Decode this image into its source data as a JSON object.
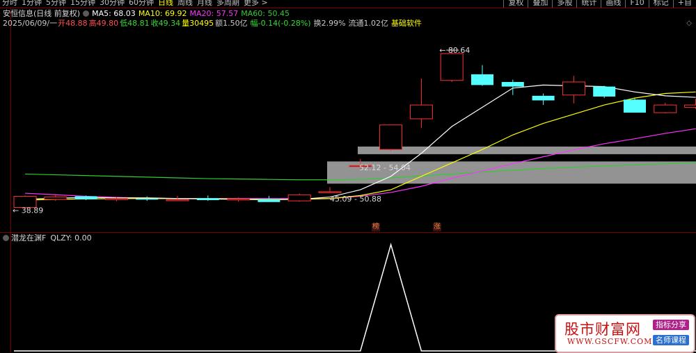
{
  "toolbar": {
    "periods": [
      "分时",
      "1分钟",
      "5分钟",
      "15分钟",
      "30分钟",
      "60分钟",
      "日线",
      "周线",
      "月线",
      "多周期",
      "更多 >"
    ],
    "active_period": "日线",
    "right_buttons": [
      "复权",
      "叠加",
      "多股",
      "统计",
      "画线",
      "F10",
      "标记",
      "+自"
    ]
  },
  "header": {
    "stock": "安恒信息(日线 前复权)",
    "ma5": "MA5: 68.03",
    "ma10": "MA10: 69.92",
    "ma20": "MA20: 57.57",
    "ma60": "MA60: 50.45",
    "date": "2025/06/09/一",
    "open": "开48.88",
    "high": "高49.80",
    "low": "低48.81",
    "close": "收49.34",
    "volume": "量30495",
    "amount": "额1.50亿",
    "change": "幅-0.14(-0.28%)",
    "turnover": "换2.99%",
    "float": "流通1.02亿",
    "sector": "基础软件",
    "corner": "◇"
  },
  "price_labels": {
    "high_mark": "80.64",
    "low_mark": "38.89",
    "zone_upper": "52.12 - 54.04",
    "zone_lower": "45.09 - 50.88"
  },
  "markers": {
    "m1": "榜",
    "m2": "涨"
  },
  "indicator": {
    "name": "潜龙在渊F",
    "value": "QLZY: 0.00"
  },
  "watermark": {
    "title": "股市财富网",
    "url": "WWW.GSCFW.COM",
    "tag1": "指标分享",
    "tag2": "名师课程"
  },
  "colors": {
    "up": "#ff3232",
    "down": "#54ffff",
    "ma5": "#ffffff",
    "ma10": "#ffff00",
    "ma20": "#ff33ff",
    "ma60": "#33cc33",
    "zone": "#a0a0a0"
  },
  "chart_data": {
    "type": "candlestick",
    "y_range": [
      35,
      85
    ],
    "candles": [
      {
        "o": 38.9,
        "h": 42.0,
        "l": 38.89,
        "c": 41.8
      },
      {
        "o": 41.0,
        "h": 42.4,
        "l": 40.6,
        "c": 41.6
      },
      {
        "o": 41.8,
        "h": 42.0,
        "l": 40.8,
        "c": 41.0
      },
      {
        "o": 41.0,
        "h": 41.6,
        "l": 40.5,
        "c": 41.2
      },
      {
        "o": 41.2,
        "h": 41.8,
        "l": 40.6,
        "c": 41.0
      },
      {
        "o": 40.8,
        "h": 41.9,
        "l": 40.6,
        "c": 40.9
      },
      {
        "o": 41.3,
        "h": 42.0,
        "l": 40.6,
        "c": 40.8
      },
      {
        "o": 41.0,
        "h": 41.5,
        "l": 40.4,
        "c": 41.1
      },
      {
        "o": 41.0,
        "h": 41.9,
        "l": 40.3,
        "c": 40.3
      },
      {
        "o": 40.6,
        "h": 42.5,
        "l": 40.4,
        "c": 42.2
      },
      {
        "o": 43.0,
        "h": 44.2,
        "l": 42.6,
        "c": 43.0
      },
      {
        "o": 49.8,
        "h": 51.5,
        "l": 48.7,
        "c": 49.8
      },
      {
        "o": 54.0,
        "h": 60.5,
        "l": 53.6,
        "c": 60.4
      },
      {
        "o": 62.0,
        "h": 72.5,
        "l": 59.6,
        "c": 65.6
      },
      {
        "o": 72.0,
        "h": 80.64,
        "l": 71.6,
        "c": 79.0
      },
      {
        "o": 73.6,
        "h": 76.0,
        "l": 70.6,
        "c": 70.8
      },
      {
        "o": 71.6,
        "h": 72.2,
        "l": 68.2,
        "c": 70.4
      },
      {
        "o": 68.0,
        "h": 68.6,
        "l": 65.6,
        "c": 66.8
      },
      {
        "o": 68.2,
        "h": 73.2,
        "l": 66.0,
        "c": 71.6
      },
      {
        "o": 70.4,
        "h": 70.6,
        "l": 67.4,
        "c": 67.8
      },
      {
        "o": 67.0,
        "h": 67.4,
        "l": 63.6,
        "c": 63.6
      },
      {
        "o": 63.6,
        "h": 66.2,
        "l": 63.4,
        "c": 65.6
      },
      {
        "o": 65.0,
        "h": 67.2,
        "l": 64.6,
        "c": 65.6
      }
    ],
    "ma5": [
      41.0,
      41.3,
      41.5,
      41.4,
      41.4,
      41.2,
      41.1,
      41.0,
      40.9,
      41.0,
      41.6,
      43.5,
      47.0,
      53.0,
      60.0,
      65.0,
      70.0,
      70.8,
      70.6,
      70.4,
      69.0,
      68.0,
      67.6
    ],
    "ma10": [
      40.8,
      41.0,
      41.1,
      41.2,
      41.2,
      41.2,
      41.2,
      41.1,
      41.0,
      41.0,
      41.2,
      42.0,
      43.5,
      47.0,
      50.5,
      54.0,
      57.8,
      60.8,
      63.2,
      65.6,
      67.4,
      68.6,
      69.0
    ],
    "ma20": [
      42.6,
      42.2,
      41.8,
      41.5,
      41.3,
      41.2,
      41.2,
      41.2,
      41.2,
      41.2,
      41.2,
      41.8,
      42.8,
      44.4,
      46.5,
      48.4,
      50.3,
      52.1,
      53.9,
      55.5,
      56.8,
      58.2,
      59.4
    ],
    "ma60": [
      47.6,
      47.4,
      47.2,
      47.0,
      46.8,
      46.6,
      46.4,
      46.3,
      46.2,
      46.1,
      46.1,
      46.2,
      46.6,
      47.1,
      47.6,
      48.1,
      48.6,
      49.0,
      49.4,
      49.7,
      50.0,
      50.3,
      50.6
    ],
    "zones": [
      {
        "low": 52.12,
        "high": 54.04
      },
      {
        "low": 45.09,
        "high": 50.88
      }
    ],
    "indicator": {
      "name": "QLZY",
      "values": [
        0,
        0,
        0,
        0,
        0,
        0,
        0,
        0,
        0,
        0,
        0,
        0,
        1,
        0,
        0,
        0,
        0,
        0,
        0,
        0,
        0,
        0,
        0
      ],
      "y_range": [
        0,
        1
      ]
    }
  }
}
